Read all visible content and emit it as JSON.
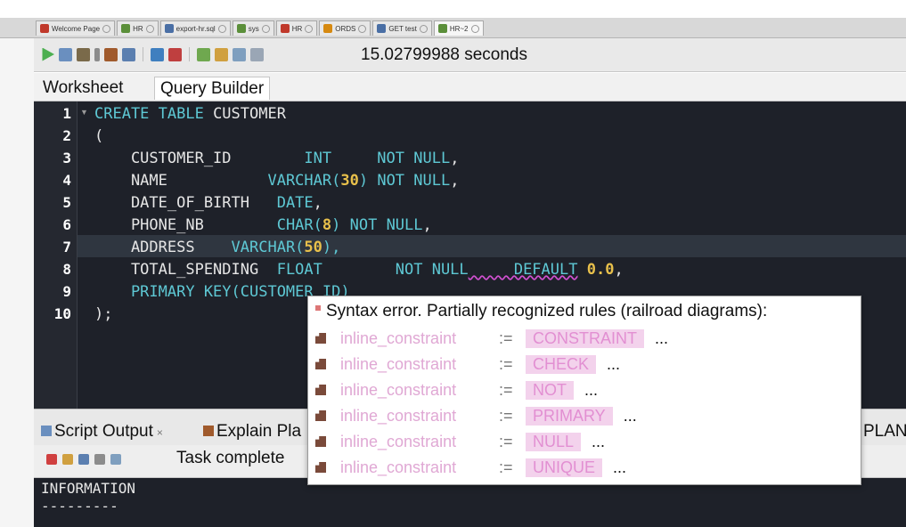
{
  "tabs": [
    {
      "label": "Welcome Page",
      "icon": "welcome-icon",
      "color": "#c0392b"
    },
    {
      "label": "HR",
      "icon": "db-connection-icon",
      "color": "#5b8f3a"
    },
    {
      "label": "export-hr.sql",
      "icon": "sql-file-icon",
      "color": "#4a6fa5"
    },
    {
      "label": "sys",
      "icon": "db-connection-icon",
      "color": "#5b8f3a"
    },
    {
      "label": "HR",
      "icon": "user-icon",
      "color": "#c0392b"
    },
    {
      "label": "ORDS",
      "icon": "ords-icon",
      "color": "#d68910"
    },
    {
      "label": "GET test",
      "icon": "rest-icon",
      "color": "#4a6fa5"
    },
    {
      "label": "HR~2",
      "icon": "db-connection-icon",
      "color": "#5b8f3a"
    }
  ],
  "toolbar": {
    "timing": "15.02799988 seconds"
  },
  "worksheet_tabs": [
    "Worksheet",
    "Query Builder"
  ],
  "editor": {
    "line_numbers": [
      "1",
      "2",
      "3",
      "4",
      "5",
      "6",
      "7",
      "8",
      "9",
      "10"
    ],
    "lines": {
      "l1_a": "CREATE TABLE",
      "l1_b": " CUSTOMER",
      "l2": "(",
      "l3_a": "    CUSTOMER_ID",
      "l3_b": "        INT",
      "l3_c": "     NOT NULL",
      "l3_d": ",",
      "l4_a": "    NAME",
      "l4_b": "           VARCHAR(",
      "l4_c": "30",
      "l4_d": ")",
      "l4_e": " NOT NULL",
      "l4_f": ",",
      "l5_a": "    DATE_OF_BIRTH",
      "l5_b": "   DATE",
      "l5_c": ",",
      "l6_a": "    PHONE_NB",
      "l6_b": "        CHAR(",
      "l6_c": "8",
      "l6_d": ")",
      "l6_e": " NOT NULL",
      "l6_f": ",",
      "l7_a": "    ADDRESS",
      "l7_b": "    VARCHAR(",
      "l7_c": "50",
      "l7_d": "),",
      "l8_a": "    TOTAL_SPENDING",
      "l8_b": "  FLOAT",
      "l8_c": "        NOT NULL",
      "l8_d": "     DEFAULT",
      "l8_e": " 0.0",
      "l8_f": ",",
      "l9_a": "    PRIMARY KEY(CUSTOMER_ID)",
      "l10": ");"
    }
  },
  "output": {
    "tabs": [
      "Script Output",
      "Explain Pla",
      "PLAN"
    ],
    "status": "Task complete",
    "lines": [
      "INFORMATION",
      "---------"
    ]
  },
  "popup": {
    "title": "Syntax error. Partially recognized rules (railroad diagrams):",
    "rules": [
      {
        "name": "inline_constraint",
        "op": ":=",
        "keyword": "CONSTRAINT",
        "dots": "..."
      },
      {
        "name": "inline_constraint",
        "op": ":=",
        "keyword": "CHECK",
        "dots": "..."
      },
      {
        "name": "inline_constraint",
        "op": ":=",
        "keyword": "NOT",
        "dots": "..."
      },
      {
        "name": "inline_constraint",
        "op": ":=",
        "keyword": "PRIMARY",
        "dots": "..."
      },
      {
        "name": "inline_constraint",
        "op": ":=",
        "keyword": "NULL",
        "dots": "..."
      },
      {
        "name": "inline_constraint",
        "op": ":=",
        "keyword": "UNIQUE",
        "dots": "..."
      }
    ]
  },
  "colors": {
    "editor_bg": "#1e2129",
    "keyword": "#5ec8d4",
    "number": "#e8c04b",
    "rule_keyword": "#e28fd2"
  }
}
